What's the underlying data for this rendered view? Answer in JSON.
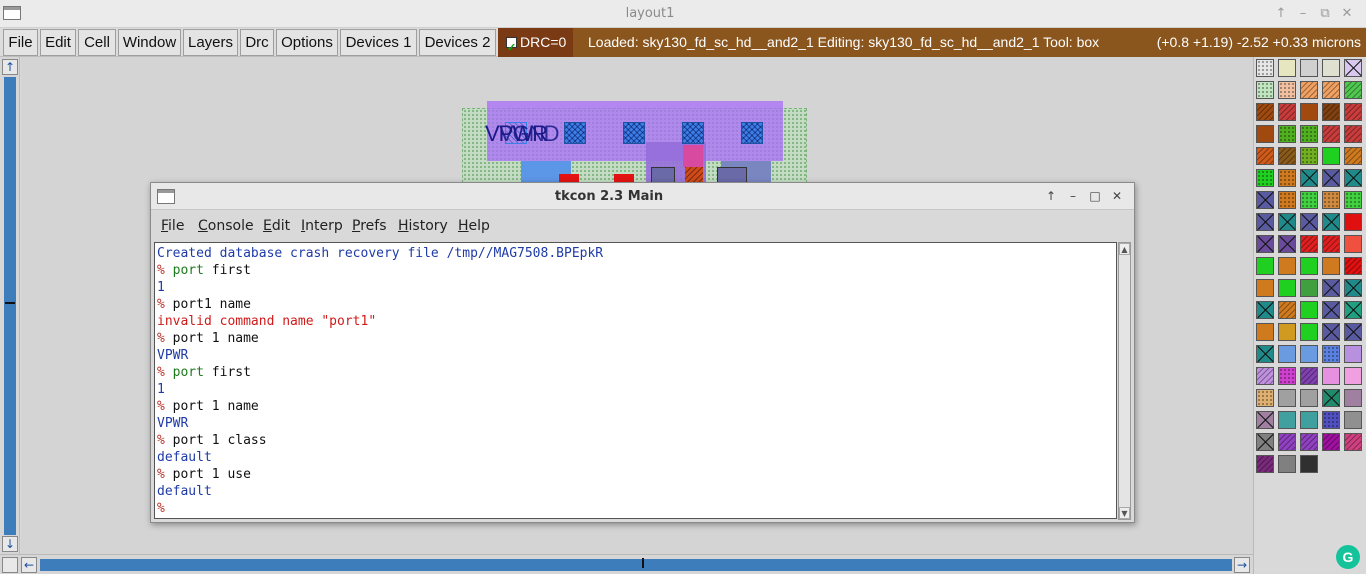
{
  "window": {
    "title": "layout1",
    "controls": [
      "↑",
      "–",
      "⧉",
      "✕"
    ]
  },
  "menubar": {
    "items": [
      "File",
      "Edit",
      "Cell",
      "Window",
      "Layers",
      "Drc",
      "Options",
      "Devices 1",
      "Devices 2"
    ],
    "drc_label": "DRC=0",
    "drc_checked": true,
    "status_loaded": "Loaded: sky130_fd_sc_hd__and2_1 Editing: sky130_fd_sc_hd__and2_1 Tool: box",
    "status_coords": "(+0.8 +1.19) -2.52 +0.33 microns",
    "colors": {
      "drc_bg": "#7a3a14",
      "status_bg": "#8a561e"
    }
  },
  "canvas": {
    "label": "VPWR",
    "scroll_arrows": {
      "up": "↑",
      "down": "↓",
      "left": "←",
      "right": "→"
    }
  },
  "tkcon": {
    "title": "tkcon 2.3 Main",
    "controls": [
      "↑",
      "–",
      "□",
      "✕"
    ],
    "menu": [
      {
        "label": "File",
        "key": "F",
        "rest": "ile"
      },
      {
        "label": "Console",
        "key": "C",
        "rest": "onsole"
      },
      {
        "label": "Edit",
        "key": "E",
        "rest": "dit"
      },
      {
        "label": "Interp",
        "key": "I",
        "rest": "nterp"
      },
      {
        "label": "Prefs",
        "key": "P",
        "rest": "refs"
      },
      {
        "label": "History",
        "key": "H",
        "rest": "istory"
      },
      {
        "label": "Help",
        "key": "H",
        "rest": "elp"
      }
    ],
    "lines": [
      {
        "type": "info",
        "text": "Created database crash recovery file /tmp//MAG7508.BPEpkR"
      },
      {
        "type": "cmd",
        "prompt": "% ",
        "cmd": "port",
        "args": " first"
      },
      {
        "type": "res",
        "text": "1"
      },
      {
        "type": "cmd",
        "prompt": "% ",
        "cmd": "",
        "args": "port1 name"
      },
      {
        "type": "err",
        "text": "invalid command name \"port1\""
      },
      {
        "type": "cmd",
        "prompt": "% ",
        "cmd": "",
        "args": "port 1 name"
      },
      {
        "type": "res",
        "text": "VPWR"
      },
      {
        "type": "cmd",
        "prompt": "% ",
        "cmd": "port",
        "args": " first"
      },
      {
        "type": "res",
        "text": "1"
      },
      {
        "type": "cmd",
        "prompt": "% ",
        "cmd": "",
        "args": "port 1 name"
      },
      {
        "type": "res",
        "text": "VPWR"
      },
      {
        "type": "cmd",
        "prompt": "% ",
        "cmd": "",
        "args": "port 1 class"
      },
      {
        "type": "res",
        "text": "default"
      },
      {
        "type": "cmd",
        "prompt": "% ",
        "cmd": "",
        "args": "port 1 use"
      },
      {
        "type": "res",
        "text": "default"
      },
      {
        "type": "cmd",
        "prompt": "%",
        "cmd": "",
        "args": ""
      }
    ]
  },
  "palette": {
    "swatches": [
      [
        "#e6e6e6",
        "#e6e6c0",
        "#d0d0d0",
        "#e0e0d0",
        "#d8c8f0"
      ],
      [
        "#bfe6bf",
        "#f0c0a0",
        "#f0a060",
        "#f0a060",
        "#50c850"
      ],
      [
        "#a04a10",
        "#c83c3c",
        "#a04a10",
        "#804010",
        "#c83c3c"
      ],
      [
        "#a04a10",
        "#50b020",
        "#50b020",
        "#c83c3c",
        "#c83c3c"
      ],
      [
        "#d05a1a",
        "#8a5a1a",
        "#70b020",
        "#20d020",
        "#d07a20"
      ],
      [
        "#20d020",
        "#d07a20",
        "#208a8a",
        "#5a5aa0",
        "#208a8a"
      ],
      [
        "#5a5aa0",
        "#d07a20",
        "#40d040",
        "#d08a40",
        "#40d040"
      ],
      [
        "#5a5aa0",
        "#208a8a",
        "#5a5aa0",
        "#208a8a",
        "#e01010"
      ],
      [
        "#6a4a9a",
        "#6a4a9a",
        "#e02020",
        "#e02020",
        "#f05040"
      ],
      [
        "#20d020",
        "#d07a20",
        "#20d020",
        "#d07a20",
        "#e01010"
      ],
      [
        "#d07a20",
        "#20d020",
        "#40a040",
        "#5a5aa0",
        "#208a8a"
      ],
      [
        "#208a8a",
        "#d07a20",
        "#20d020",
        "#5a5aa0",
        "#20a080"
      ],
      [
        "#d07a20",
        "#d09a20",
        "#20d020",
        "#5a5aa0",
        "#5a5aa0"
      ],
      [
        "#208a8a",
        "#6a9ae0",
        "#6a9ae0",
        "#5a80e0",
        "#b890e0"
      ],
      [
        "#c090e0",
        "#d040d0",
        "#8040b0",
        "#e890e0",
        "#f0a0e0"
      ],
      [
        "#e0b070",
        "#a0a0a0",
        "#a0a0a0",
        "#208a6a",
        "#a080a0"
      ],
      [
        "#a080a0",
        "#40a0a0",
        "#40a0a0",
        "#5050c0",
        "#909090"
      ],
      [
        "#808080",
        "#9040c0",
        "#9040c0",
        "#a010a0",
        "#d04080"
      ],
      [
        "#7a2a7a",
        "#808080",
        "#303030"
      ]
    ],
    "patterns": [
      [
        "d",
        "",
        "",
        "",
        "x"
      ],
      [
        "d",
        "d",
        "h",
        "h",
        "h"
      ],
      [
        "h",
        "h",
        "",
        "h",
        "h"
      ],
      [
        "",
        "d",
        "d",
        "h",
        "h"
      ],
      [
        "h",
        "h",
        "d",
        "",
        "h"
      ],
      [
        "d",
        "d",
        "x",
        "x",
        "x"
      ],
      [
        "x",
        "d",
        "d",
        "d",
        "d"
      ],
      [
        "x",
        "x",
        "x",
        "x",
        ""
      ],
      [
        "x",
        "x",
        "h",
        "h",
        ""
      ],
      [
        "",
        "",
        "",
        "",
        "h"
      ],
      [
        "",
        "",
        "",
        "x",
        "x"
      ],
      [
        "x",
        "h",
        "",
        "x",
        "x"
      ],
      [
        "",
        "",
        "",
        "x",
        "x"
      ],
      [
        "x",
        "",
        "",
        "d",
        ""
      ],
      [
        "h",
        "d",
        "h",
        "",
        ""
      ],
      [
        "d",
        "",
        "",
        "x",
        ""
      ],
      [
        "x",
        "",
        "",
        "d",
        ""
      ],
      [
        "x",
        "h",
        "h",
        "h",
        "h"
      ],
      [
        "h",
        "",
        ""
      ]
    ]
  }
}
